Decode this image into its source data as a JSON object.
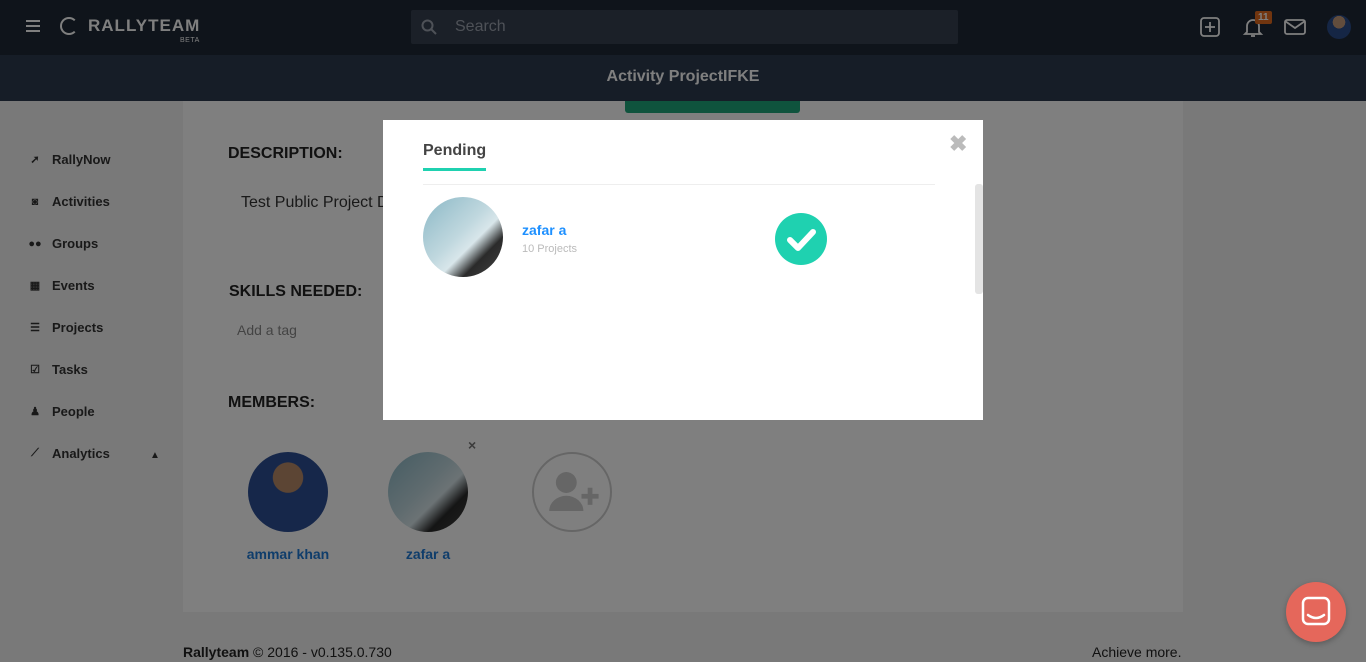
{
  "topbar": {
    "logo_text": "RALLYTEAM",
    "logo_beta": "BETA",
    "search_placeholder": "Search",
    "notifications_count": "11"
  },
  "subheader": {
    "title": "Activity ProjectIFKE"
  },
  "sidebar": {
    "items": [
      {
        "label": "RallyNow",
        "icon": "rocket-icon"
      },
      {
        "label": "Activities",
        "icon": "rss-icon"
      },
      {
        "label": "Groups",
        "icon": "users-icon"
      },
      {
        "label": "Events",
        "icon": "calendar-icon"
      },
      {
        "label": "Projects",
        "icon": "list-icon"
      },
      {
        "label": "Tasks",
        "icon": "check-square-icon"
      },
      {
        "label": "People",
        "icon": "user-icon"
      },
      {
        "label": "Analytics",
        "icon": "chart-icon"
      }
    ]
  },
  "main": {
    "description_title": "DESCRIPTION:",
    "description_text": "Test Public Project D",
    "skills_title": "SKILLS NEEDED:",
    "tag_placeholder": "Add a tag",
    "members_title": "MEMBERS:",
    "members": [
      {
        "name": "ammar khan"
      },
      {
        "name": "zafar a"
      }
    ],
    "remove_symbol": "×"
  },
  "footer": {
    "brand": "Rallyteam",
    "copyright": " © 2016 - v0.135.0.730",
    "tagline": "Achieve more."
  },
  "modal": {
    "tab_label": "Pending",
    "close_symbol": "✖",
    "pending": [
      {
        "name": "zafar a",
        "subtitle": "10 Projects"
      }
    ]
  },
  "colors": {
    "accent": "#1fd1b0",
    "link": "#1e90ff",
    "topbar": "#1f2937",
    "badge": "#e36b1e",
    "chat": "#e5675b"
  }
}
